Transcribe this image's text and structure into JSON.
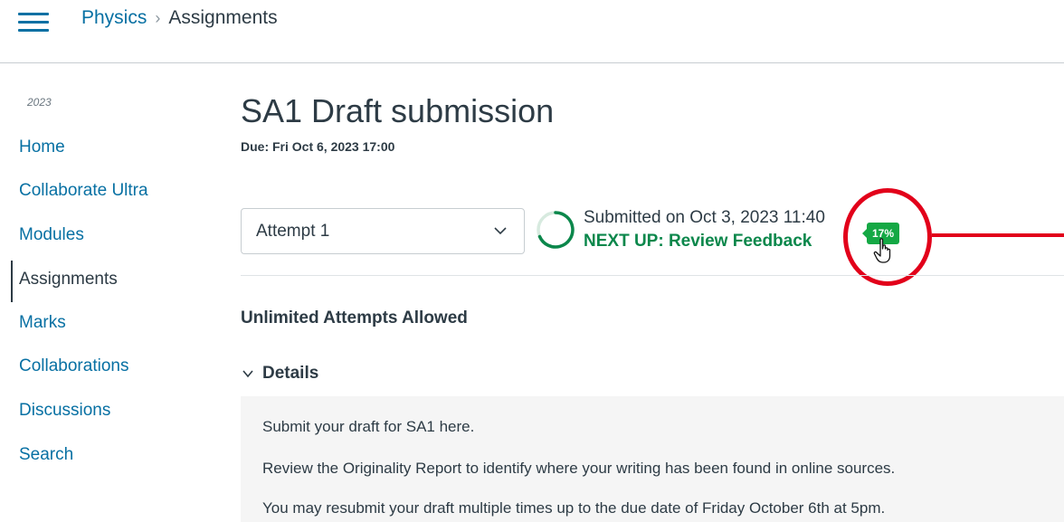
{
  "breadcrumb": {
    "course": "Physics",
    "separator": "›",
    "current": "Assignments"
  },
  "sidebar": {
    "term": "2023",
    "items": [
      {
        "label": "Home"
      },
      {
        "label": "Collaborate Ultra"
      },
      {
        "label": "Modules"
      },
      {
        "label": "Assignments"
      },
      {
        "label": "Marks"
      },
      {
        "label": "Collaborations"
      },
      {
        "label": "Discussions"
      },
      {
        "label": "Search"
      }
    ]
  },
  "assignment": {
    "title": "SA1 Draft submission",
    "due": "Due: Fri Oct 6, 2023 17:00",
    "attempt_selected": "Attempt 1",
    "submitted_on": "Submitted on Oct 3, 2023 11:40",
    "next_up": "NEXT UP: Review Feedback",
    "originality_score": "17%",
    "attempts_allowed": "Unlimited Attempts Allowed",
    "details_label": "Details",
    "details_lines": [
      "Submit your draft for SA1 here.",
      "Review the Originality Report to identify where your writing has been found in online sources.",
      "You may resubmit your draft multiple times up to the due date of Friday October 6th at 5pm."
    ]
  },
  "colors": {
    "link": "#0770a3",
    "success": "#0b874b",
    "badge": "#14a844",
    "annotation": "#e2001a"
  },
  "icons": {
    "menu": "hamburger-icon",
    "select": "chevron-down-icon",
    "progress": "progress-ring-icon",
    "cursor": "hand-pointer-icon"
  }
}
